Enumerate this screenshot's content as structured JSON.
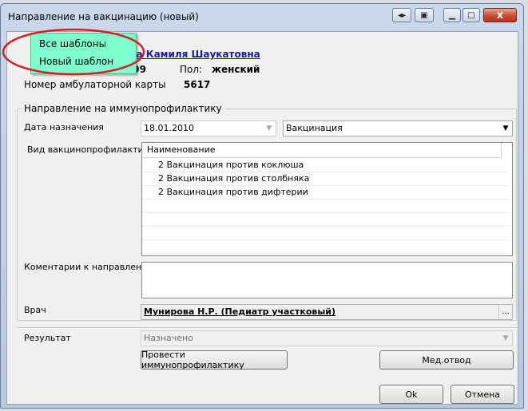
{
  "window": {
    "title": "Направление на вакцинацию  (новый)",
    "buttons": {
      "close": "x"
    }
  },
  "popup_menu": {
    "items": [
      "Все шаблоны",
      "Новый шаблон"
    ]
  },
  "patient": {
    "name_visible": "лина Камиля Шаукатовна",
    "dob_visible": ".1999",
    "sex_label": "Пол:",
    "sex_value": "женский",
    "card_label": "Номер амбулаторной карты",
    "card_value": "5617"
  },
  "group": {
    "title": "Направление на иммунопрофилактику",
    "date_label": "Дата назначения",
    "date_value": "18.01.2010",
    "type_value": "Вакцинация",
    "vac_type_label": "Вид вакцинопрофилактики",
    "list_header": "Наименование",
    "list_rows": [
      "2 Вакцинация против коклюша",
      "2 Вакцинация против столбняка",
      "2 Вакцинация против дифтерии"
    ],
    "comments_label": "Коментарии к направлению",
    "doctor_label": "Врач",
    "doctor_value": "Мунирова Н.Р. (Педиатр участковый)",
    "doctor_button": "..."
  },
  "result": {
    "label": "Результат",
    "value": "Назначено"
  },
  "buttons": {
    "perform": "Провести иммунопрофилактику",
    "medotvod": "Мед.отвод",
    "ok": "Ok",
    "cancel": "Отмена"
  },
  "colors": {
    "popup_bg": "#7dffcf",
    "highlight_ellipse": "#d42020",
    "link": "#1a1a9a"
  }
}
